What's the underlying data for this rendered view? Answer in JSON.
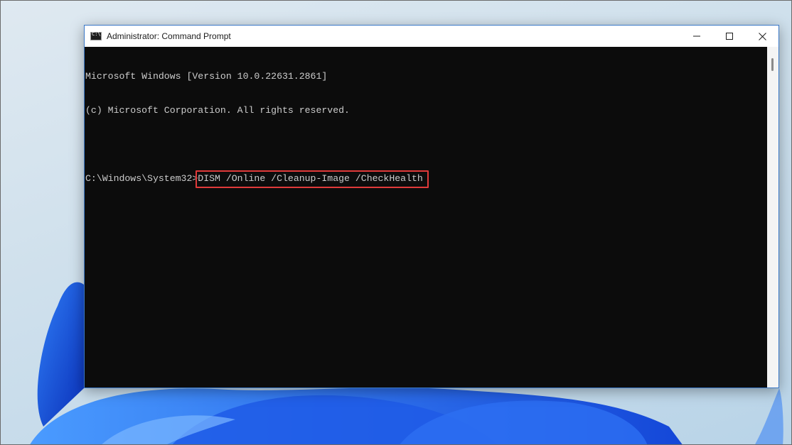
{
  "window": {
    "title": "Administrator: Command Prompt",
    "icon": "cmd-icon",
    "controls": [
      "minimize-icon",
      "maximize-icon",
      "close-icon"
    ]
  },
  "console": {
    "lines": [
      "Microsoft Windows [Version 10.0.22631.2861]",
      "(c) Microsoft Corporation. All rights reserved.",
      ""
    ],
    "prompt": "C:\\Windows\\System32>",
    "command": "DISM /Online /Cleanup-Image /CheckHealth"
  },
  "colors": {
    "console_bg": "#0c0c0c",
    "console_text": "#cccccc",
    "highlight_border": "#e03a3a",
    "window_border": "#3a78c7"
  }
}
